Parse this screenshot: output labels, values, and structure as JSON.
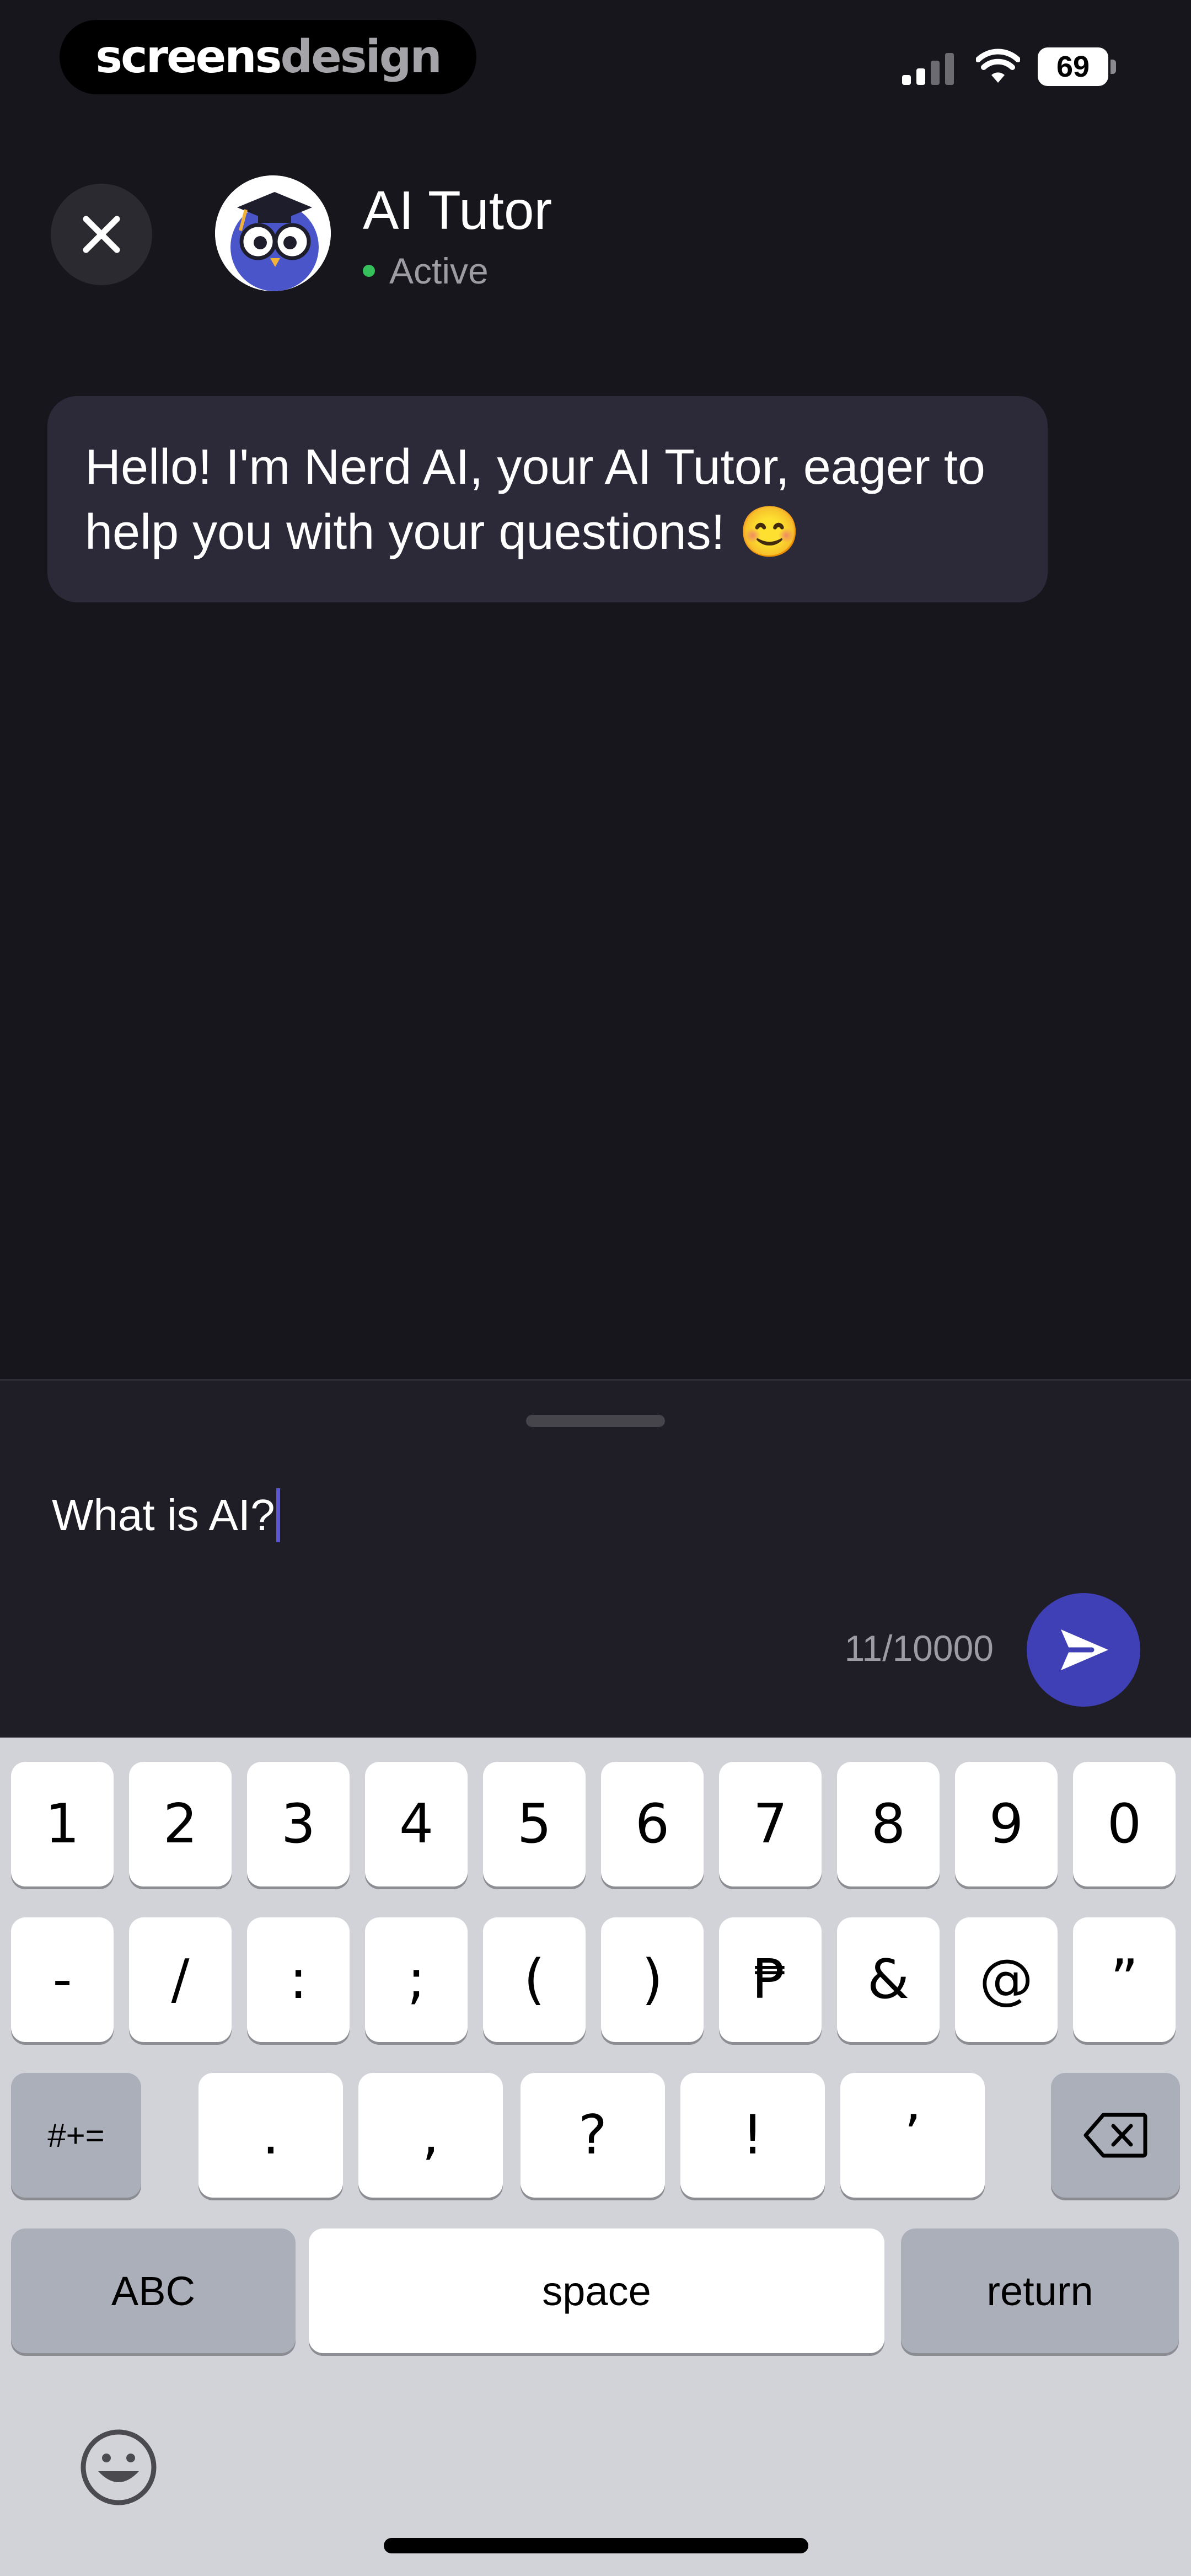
{
  "watermark": {
    "part1": "screens",
    "part2": "design"
  },
  "status_bar": {
    "battery": "69"
  },
  "header": {
    "title": "AI Tutor",
    "status": "Active"
  },
  "messages": [
    {
      "text": "Hello! I'm Nerd AI, your AI Tutor, eager to help you with your questions! 😊"
    }
  ],
  "composer": {
    "input_value": "What is AI?",
    "char_count": "11/10000"
  },
  "keyboard": {
    "row1": [
      "1",
      "2",
      "3",
      "4",
      "5",
      "6",
      "7",
      "8",
      "9",
      "0"
    ],
    "row2": [
      "-",
      "/",
      ":",
      ";",
      "(",
      ")",
      "₱",
      "&",
      "@",
      "”"
    ],
    "row3": [
      ".",
      ",",
      "?",
      "!",
      "’"
    ],
    "symbols_toggle": "#+=",
    "abc_key": "ABC",
    "space_key": "space",
    "return_key": "return"
  },
  "colors": {
    "background": "#17161d",
    "bubble": "#2c2a38",
    "accent": "#3f3fb6",
    "active": "#35c05b"
  }
}
